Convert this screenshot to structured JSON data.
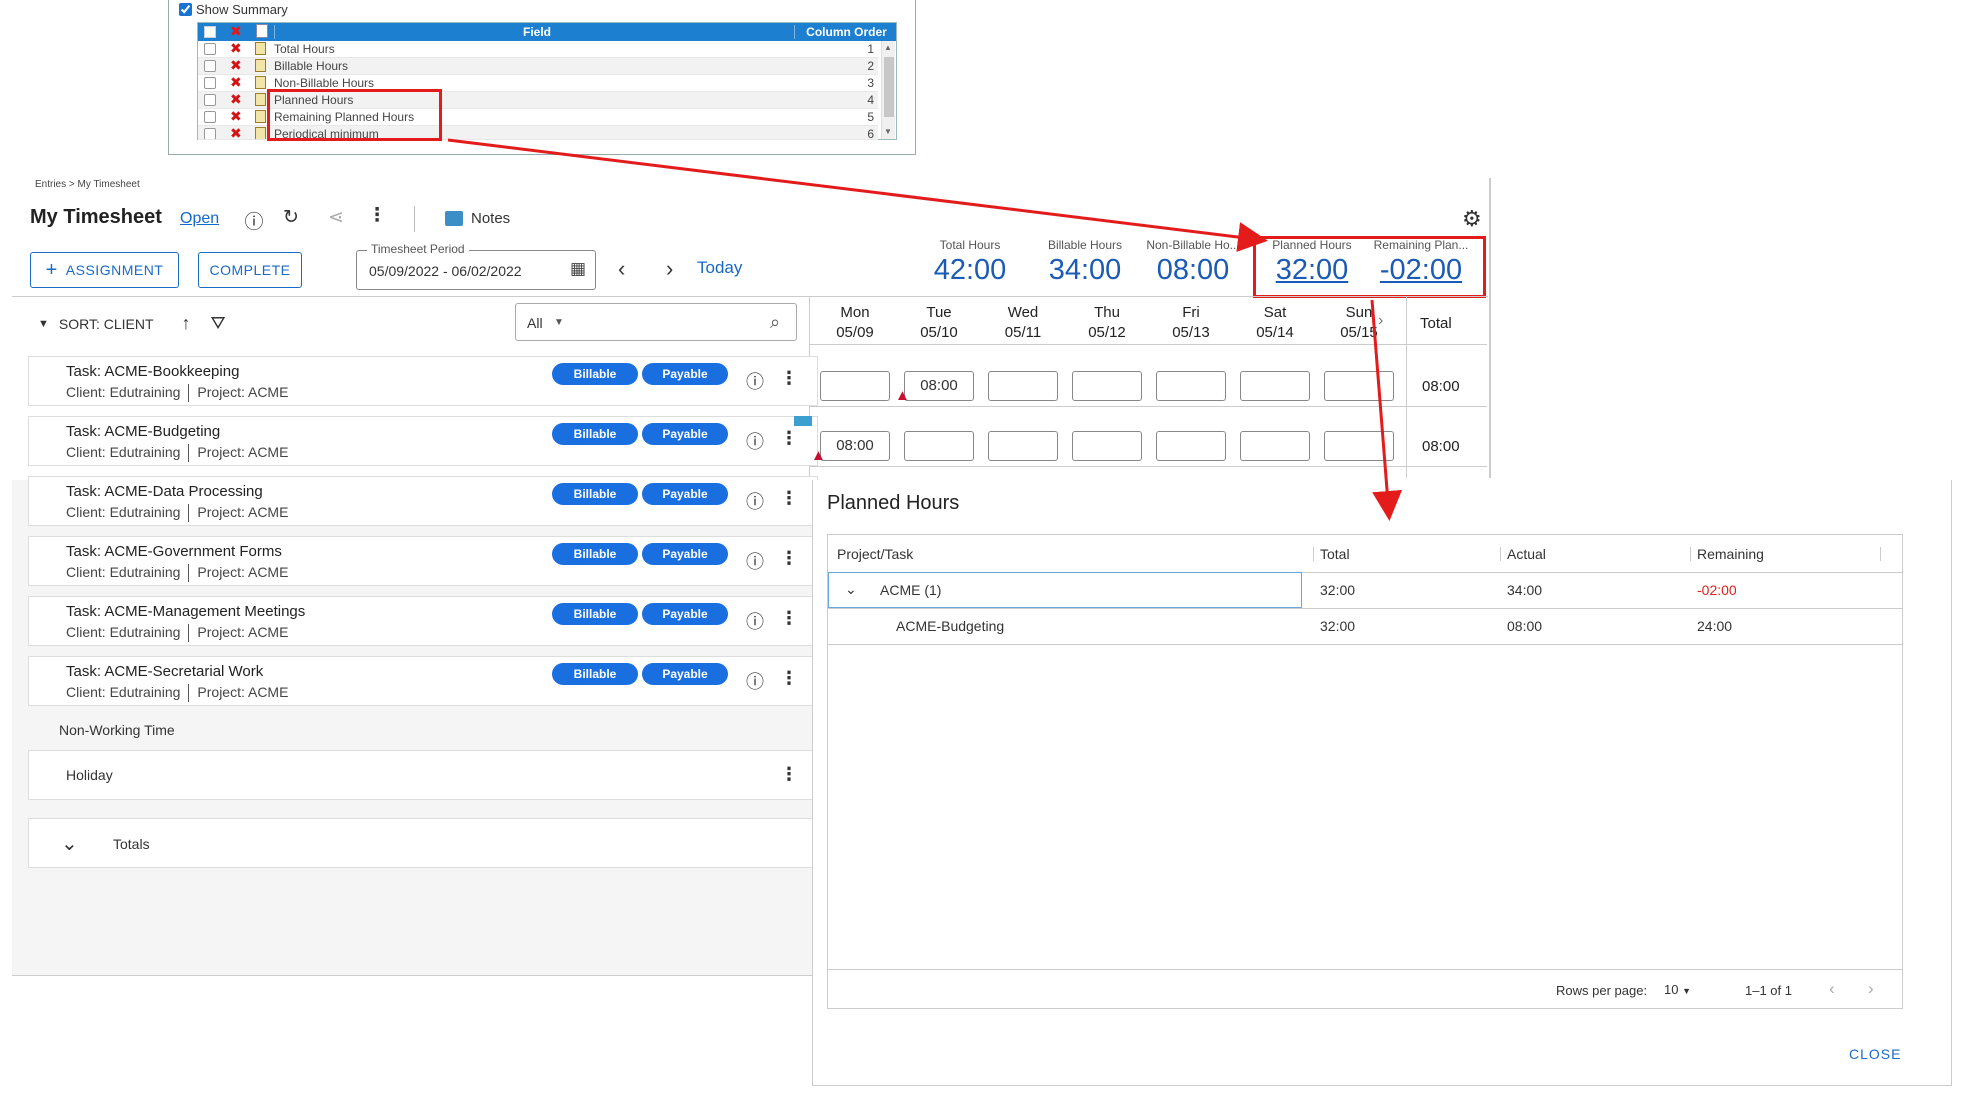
{
  "config": {
    "show_summary_label": "Show Summary",
    "field_header": "Field",
    "order_header": "Column Order",
    "rows": [
      {
        "field": "Total Hours",
        "order": "1"
      },
      {
        "field": "Billable Hours",
        "order": "2"
      },
      {
        "field": "Non-Billable Hours",
        "order": "3"
      },
      {
        "field": "Planned Hours",
        "order": "4"
      },
      {
        "field": "Remaining Planned Hours",
        "order": "5"
      },
      {
        "field": "Periodical minimum",
        "order": "6"
      }
    ]
  },
  "header": {
    "breadcrumb": "Entries > My Timesheet",
    "title": "My Timesheet",
    "status": "Open",
    "notes_label": "Notes",
    "assignment_label": "ASSIGNMENT",
    "complete_label": "COMPLETE",
    "period_label": "Timesheet Period",
    "period_value": "05/09/2022 - 06/02/2022",
    "today_label": "Today"
  },
  "summary": [
    {
      "label": "Total Hours",
      "value": "42:00"
    },
    {
      "label": "Billable Hours",
      "value": "34:00"
    },
    {
      "label": "Non-Billable Ho...",
      "value": "08:00"
    },
    {
      "label": "Planned Hours",
      "value": "32:00"
    },
    {
      "label": "Remaining Plan...",
      "value": "-02:00"
    }
  ],
  "toolbar": {
    "sort_label": "SORT: CLIENT",
    "filter_value": "All"
  },
  "days": [
    {
      "dow": "Mon",
      "date": "05/09"
    },
    {
      "dow": "Tue",
      "date": "05/10"
    },
    {
      "dow": "Wed",
      "date": "05/11"
    },
    {
      "dow": "Thu",
      "date": "05/12"
    },
    {
      "dow": "Fri",
      "date": "05/13"
    },
    {
      "dow": "Sat",
      "date": "05/14"
    },
    {
      "dow": "Sun",
      "date": "05/15"
    }
  ],
  "total_header": "Total",
  "tags": {
    "billable": "Billable",
    "payable": "Payable"
  },
  "tasks": [
    {
      "name": "Task: ACME-Bookkeeping",
      "client": "Client: Edutraining",
      "project": "Project: ACME"
    },
    {
      "name": "Task: ACME-Budgeting",
      "client": "Client: Edutraining",
      "project": "Project: ACME"
    },
    {
      "name": "Task: ACME-Data Processing",
      "client": "Client: Edutraining",
      "project": "Project: ACME"
    },
    {
      "name": "Task: ACME-Government Forms",
      "client": "Client: Edutraining",
      "project": "Project: ACME"
    },
    {
      "name": "Task: ACME-Management Meetings",
      "client": "Client: Edutraining",
      "project": "Project: ACME"
    },
    {
      "name": "Task: ACME-Secretarial Work",
      "client": "Client: Edutraining",
      "project": "Project: ACME"
    }
  ],
  "grid_rows": [
    {
      "cells": [
        "",
        "08:00",
        "",
        "",
        "",
        "",
        ""
      ],
      "total": "08:00"
    },
    {
      "cells": [
        "08:00",
        "",
        "",
        "",
        "",
        "",
        ""
      ],
      "total": "08:00"
    }
  ],
  "non_working_label": "Non-Working Time",
  "holiday_label": "Holiday",
  "totals_label": "Totals",
  "dialog": {
    "title": "Planned Hours",
    "columns": [
      "Project/Task",
      "Total",
      "Actual",
      "Remaining"
    ],
    "rows": [
      {
        "name": "ACME (1)",
        "total": "32:00",
        "actual": "34:00",
        "remaining": "-02:00"
      },
      {
        "name": "ACME-Budgeting",
        "total": "32:00",
        "actual": "08:00",
        "remaining": "24:00"
      }
    ],
    "rows_per_page_label": "Rows per page:",
    "rows_per_page_value": "10",
    "range_label": "1–1 of 1",
    "close_label": "CLOSE"
  },
  "colors": {
    "accent": "#1a6ac6",
    "pill": "#1a6fe0",
    "highlight": "#e41b1b",
    "negative": "#e02020"
  }
}
